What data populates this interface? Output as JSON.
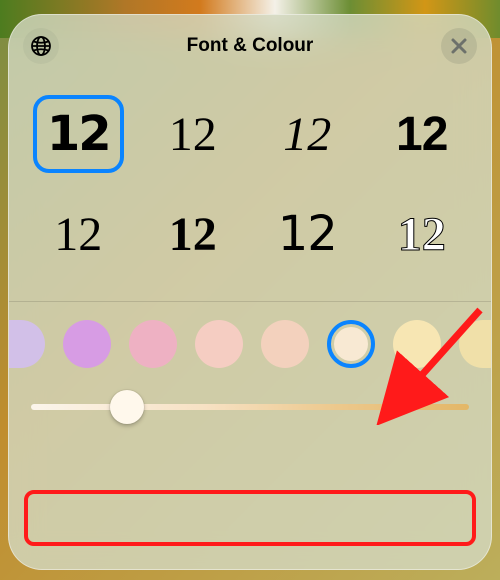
{
  "header": {
    "title": "Font & Colour",
    "globe_icon": "globe-icon",
    "close_icon": "close-icon"
  },
  "fonts": {
    "sample": "12",
    "selected_index": 0,
    "count": 8
  },
  "colours": {
    "swatches": [
      "#d2c0e8",
      "#d79ce4",
      "#eeb1c3",
      "#f5cdc2",
      "#f3d1bd",
      "#f8e9d3",
      "#f7e6b3"
    ],
    "selected_index": 5
  },
  "slider": {
    "value": 22,
    "min": 0,
    "max": 100,
    "gradient_from": "#fbf5eb",
    "gradient_to": "#e3b767"
  },
  "annotations": {
    "primary": "red-arrow",
    "highlight": "slider-highlight-box"
  }
}
